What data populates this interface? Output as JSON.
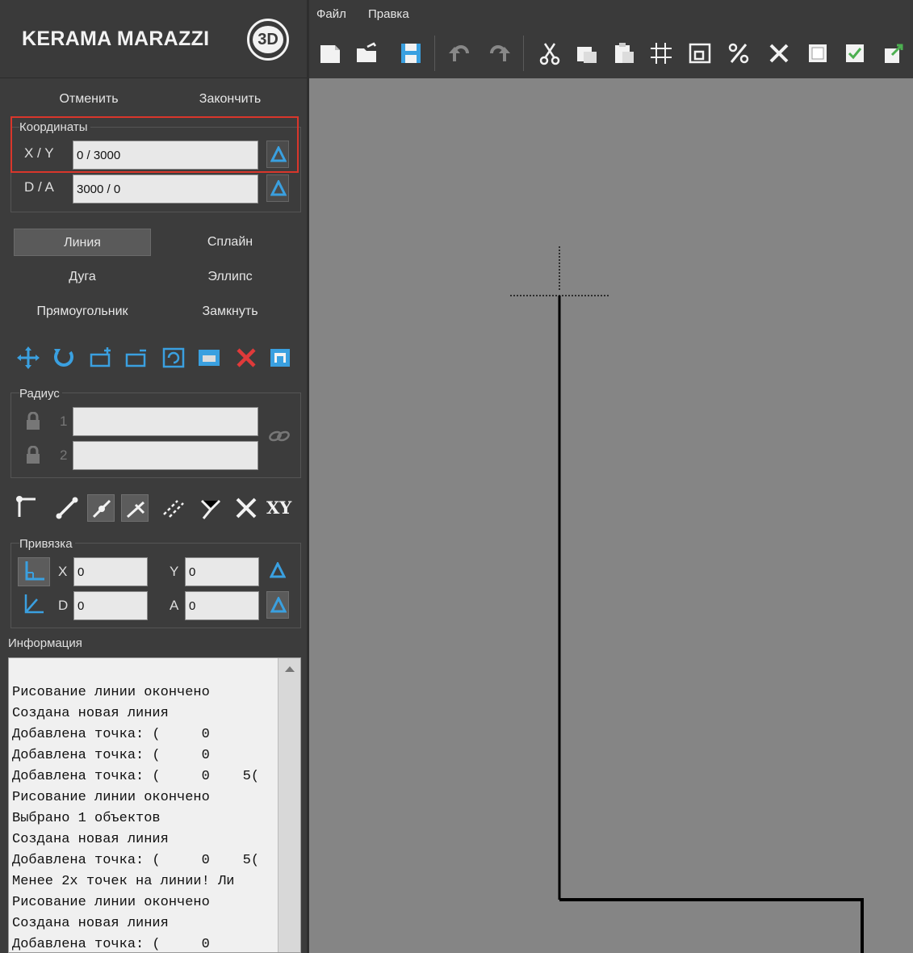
{
  "app": {
    "brand": "KERAMA MARAZZI",
    "badge": "3D"
  },
  "menu": {
    "file": "Файл",
    "edit": "Правка"
  },
  "toolbar": {
    "icons": [
      "new-file-icon",
      "open-folder-icon",
      "save-icon",
      "undo-icon",
      "redo-icon",
      "cut-icon",
      "copy-icon",
      "paste-icon",
      "grid-icon",
      "frame-icon",
      "percent-icon",
      "delete-icon",
      "white-square-icon",
      "checked-square-icon",
      "export-icon"
    ]
  },
  "panel": {
    "cancel": "Отменить",
    "finish": "Закончить",
    "coords": {
      "title": "Координаты",
      "xy_label": "X / Y",
      "xy_value": "0 / 3000",
      "da_label": "D / A",
      "da_value": "3000 / 0"
    },
    "modes": {
      "line": "Линия",
      "spline": "Сплайн",
      "arc": "Дуга",
      "ellipse": "Эллипс",
      "rectangle": "Прямоугольник",
      "close": "Замкнуть"
    },
    "radius": {
      "title": "Радиус",
      "r1_label": "1",
      "r1_value": "",
      "r2_label": "2",
      "r2_value": ""
    },
    "snap": {
      "title": "Привязка",
      "x_label": "X",
      "x_value": "0",
      "y_label": "Y",
      "y_value": "0",
      "d_label": "D",
      "d_value": "0",
      "a_label": "A",
      "a_value": "0",
      "xy_icon_text": "XY"
    },
    "info": {
      "title": "Информация",
      "lines": [
        "Рисование линии окончено",
        "Создана новая линия",
        "Добавлена точка: (     0",
        "Добавлена точка: (     0",
        "Добавлена точка: (     0    5(",
        "Рисование линии окончено",
        "Выбрано 1 объектов",
        "Создана новая линия",
        "Добавлена точка: (     0    5(",
        "Менее 2х точек на линии! Ли",
        "Рисование линии окончено",
        "Создана новая линия",
        "Добавлена точка: (     0"
      ]
    }
  },
  "colors": {
    "highlight": "#d9362b",
    "accent_triangle": "#3aa0e0",
    "canvas": "#858585"
  }
}
